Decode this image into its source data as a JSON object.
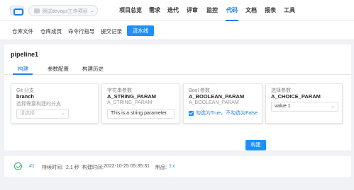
{
  "header": {
    "project_name": "测试devops工作项目",
    "nav": [
      "项目总览",
      "需求",
      "迭代",
      "评审",
      "监控",
      "代码",
      "文档",
      "报表",
      "工具"
    ],
    "active_nav": "代码"
  },
  "subnav": {
    "items": [
      "仓库文件",
      "仓库成员",
      "命令行指导",
      "提交记录"
    ],
    "active": "流水线"
  },
  "page": {
    "title": "pipeline1",
    "tabs": [
      "构建",
      "参数配置",
      "构建历史"
    ],
    "active_tab": "构建"
  },
  "params": [
    {
      "type": "Git 分支",
      "name": "branch",
      "desc": "选择需要构建的分支",
      "placeholder": "请选择"
    },
    {
      "type": "字符串参数",
      "name": "A_STRING_PARAM",
      "desc": "A_STRING_PARAM",
      "value": "This is a string parameter"
    },
    {
      "type": "Bool 参数",
      "name": "A_BOOLEAN_PARAM",
      "desc": "A_BOOLEAN_PARAM",
      "check_label": "勾选为True，不勾选为False",
      "checked": true
    },
    {
      "type": "选择参数",
      "name": "A_CHOICE_PARAM",
      "value": "value 1"
    }
  ],
  "build_button": "构建",
  "history": {
    "build_no": "#1",
    "duration_label": "持续时间:",
    "duration": "2.1 秒",
    "time_label": "构建时间:",
    "time": "2022-10-25 05:35:31",
    "artifact_label": "制品:",
    "artifact": "1.c",
    "status": "success"
  },
  "colors": {
    "accent": "#1e8fff",
    "success": "#2db36a"
  }
}
